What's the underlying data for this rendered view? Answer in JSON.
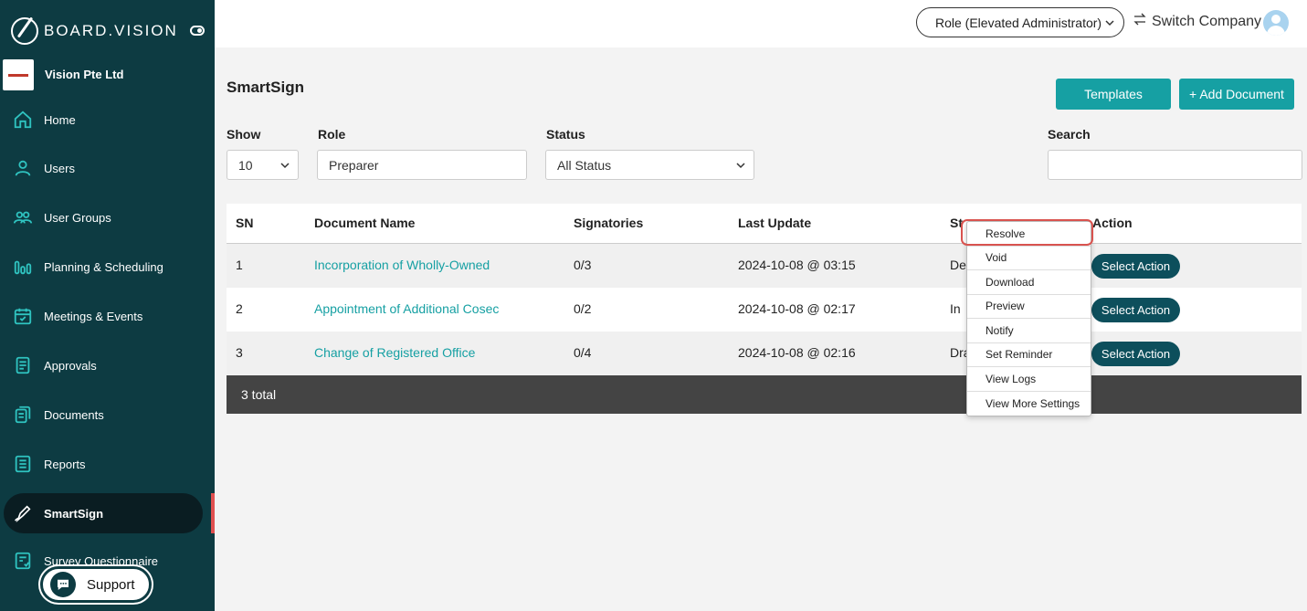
{
  "brand": {
    "name": "BOARD.VISION"
  },
  "company": {
    "name": "Vision Pte Ltd"
  },
  "sidebar": {
    "items": [
      {
        "label": "Home",
        "icon": "home-icon"
      },
      {
        "label": "Users",
        "icon": "user-icon"
      },
      {
        "label": "User Groups",
        "icon": "users-icon"
      },
      {
        "label": "Planning & Scheduling",
        "icon": "planning-icon"
      },
      {
        "label": "Meetings & Events",
        "icon": "calendar-icon"
      },
      {
        "label": "Approvals",
        "icon": "approvals-icon"
      },
      {
        "label": "Documents",
        "icon": "documents-icon"
      },
      {
        "label": "Reports",
        "icon": "reports-icon"
      },
      {
        "label": "SmartSign",
        "icon": "pen-icon",
        "active": true
      },
      {
        "label": "Survey Questionnaire",
        "icon": "survey-icon"
      }
    ],
    "support_label": "Support"
  },
  "header": {
    "role": "Role (Elevated Administrator)",
    "switch_company": "Switch Company"
  },
  "page": {
    "title": "SmartSign",
    "templates_button": "Templates",
    "add_document_button": "+ Add Document"
  },
  "filters": {
    "show_label": "Show",
    "show_value": "10",
    "role_label": "Role",
    "role_value": "Preparer",
    "status_label": "Status",
    "status_value": "All Status",
    "search_label": "Search",
    "search_value": ""
  },
  "table": {
    "headers": [
      "SN",
      "Document Name",
      "Signatories",
      "Last Update",
      "Status",
      "Action"
    ],
    "rows": [
      {
        "sn": "1",
        "name": "Incorporation of Wholly-Owned",
        "signatories": "0/3",
        "updated": "2024-10-08 @ 03:15",
        "status": "De",
        "action": "Select Action"
      },
      {
        "sn": "2",
        "name": "Appointment of Additional Cosec",
        "signatories": "0/2",
        "updated": "2024-10-08 @ 02:17",
        "status": "In",
        "action": "Select Action"
      },
      {
        "sn": "3",
        "name": "Change of Registered Office",
        "signatories": "0/4",
        "updated": "2024-10-08 @ 02:16",
        "status": "Dra",
        "action": "Select Action"
      }
    ],
    "total": "3 total"
  },
  "action_menu": {
    "items": [
      "Resolve",
      "Void",
      "Download",
      "Preview",
      "Notify",
      "Set Reminder",
      "View Logs",
      "View More Settings"
    ]
  },
  "colors": {
    "sidebar": "#0d3b42",
    "accent": "#16a0a3",
    "action_button": "#0d4f5c",
    "highlight": "#d9534f"
  }
}
